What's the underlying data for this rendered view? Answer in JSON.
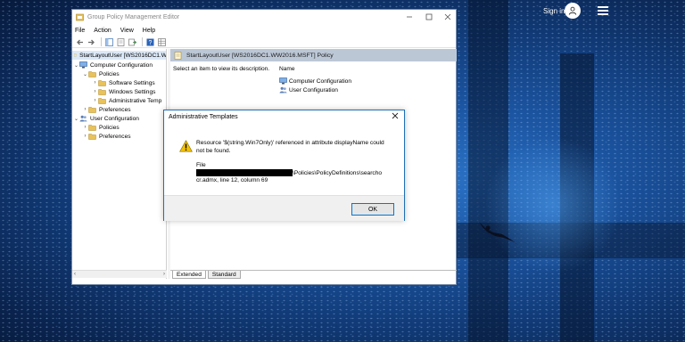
{
  "desktop": {
    "sign_in_label": "Sign in"
  },
  "window": {
    "title": "Group Policy Management Editor",
    "menu": [
      "File",
      "Action",
      "View",
      "Help"
    ],
    "tree": {
      "root": "StartLayoutUser [WS2016DC1.W",
      "items": [
        {
          "label": "Computer Configuration"
        },
        {
          "label": "Policies"
        },
        {
          "label": "Software Settings"
        },
        {
          "label": "Windows Settings"
        },
        {
          "label": "Administrative Temp"
        },
        {
          "label": "Preferences"
        },
        {
          "label": "User Configuration"
        },
        {
          "label": "Policies"
        },
        {
          "label": "Preferences"
        }
      ]
    },
    "right_pane": {
      "header": "StartLayoutUser [WS2016DC1.WW2016.MSFT] Policy",
      "description": "Select an item to view its description.",
      "column_header": "Name",
      "items": [
        "Computer Configuration",
        "User Configuration"
      ]
    },
    "tabs": [
      "Extended",
      "Standard"
    ]
  },
  "dialog": {
    "title": "Administrative Templates",
    "message": "Resource '$(string.Win7Only)' referenced in attribute displayName could not be found.",
    "file_label": "File",
    "file_path_tail": "\\Policies\\PolicyDefinitions\\searcho",
    "file_line2": "cr.admx, line 12, column 69",
    "ok_label": "OK"
  },
  "colors": {
    "accent": "#0078d7",
    "warning": "#f2c200",
    "folder": "#e8c25a"
  }
}
